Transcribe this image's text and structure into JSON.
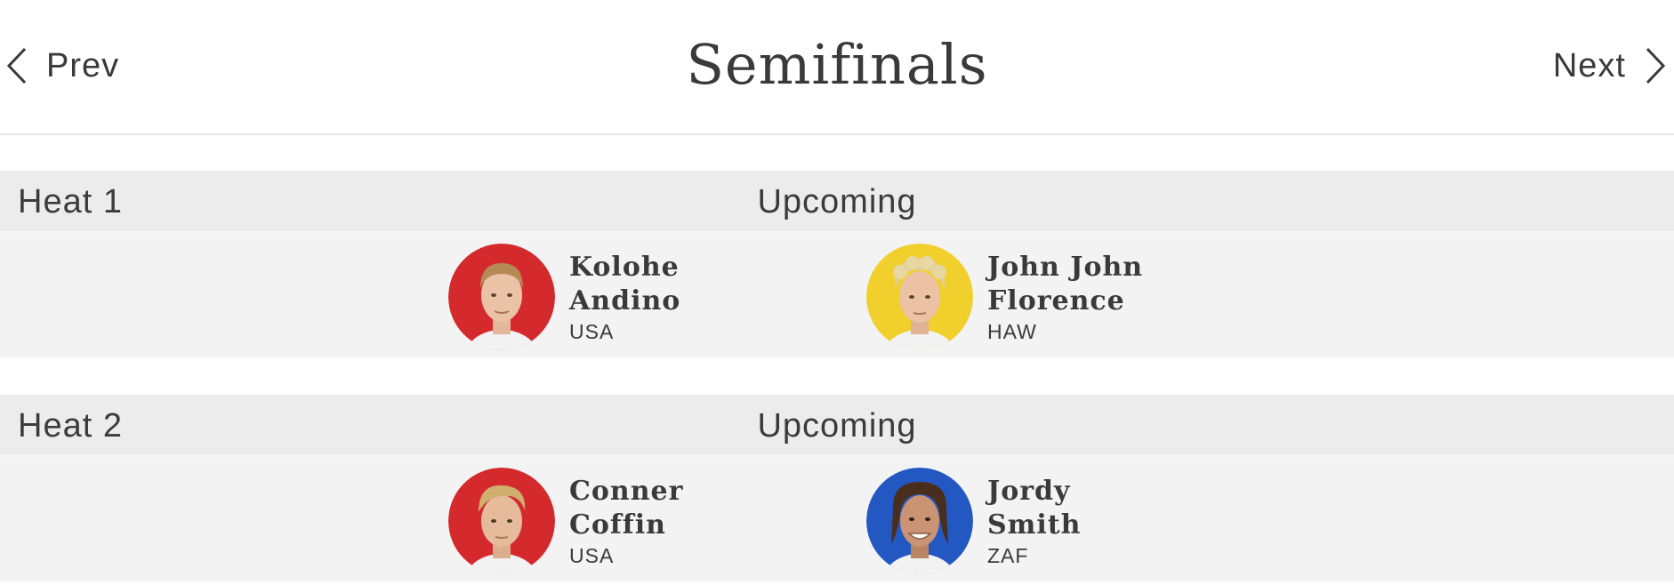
{
  "header": {
    "title": "Semifinals",
    "prev_label": "Prev",
    "next_label": "Next"
  },
  "heats": [
    {
      "name": "Heat 1",
      "status": "Upcoming",
      "athletes": [
        {
          "first": "Kolohe",
          "last": "Andino",
          "country": "USA",
          "color": "#d42a2e",
          "hair": "light-brown"
        },
        {
          "first": "John John",
          "last": "Florence",
          "country": "HAW",
          "color": "#f1cf2c",
          "hair": "blonde-curly"
        }
      ]
    },
    {
      "name": "Heat 2",
      "status": "Upcoming",
      "athletes": [
        {
          "first": "Conner",
          "last": "Coffin",
          "country": "USA",
          "color": "#d42a2e",
          "hair": "blonde"
        },
        {
          "first": "Jordy",
          "last": "Smith",
          "country": "ZAF",
          "color": "#2358c3",
          "hair": "dark-brown"
        }
      ]
    }
  ],
  "icons": {
    "prev": "chevron-left-icon",
    "next": "chevron-right-icon"
  }
}
